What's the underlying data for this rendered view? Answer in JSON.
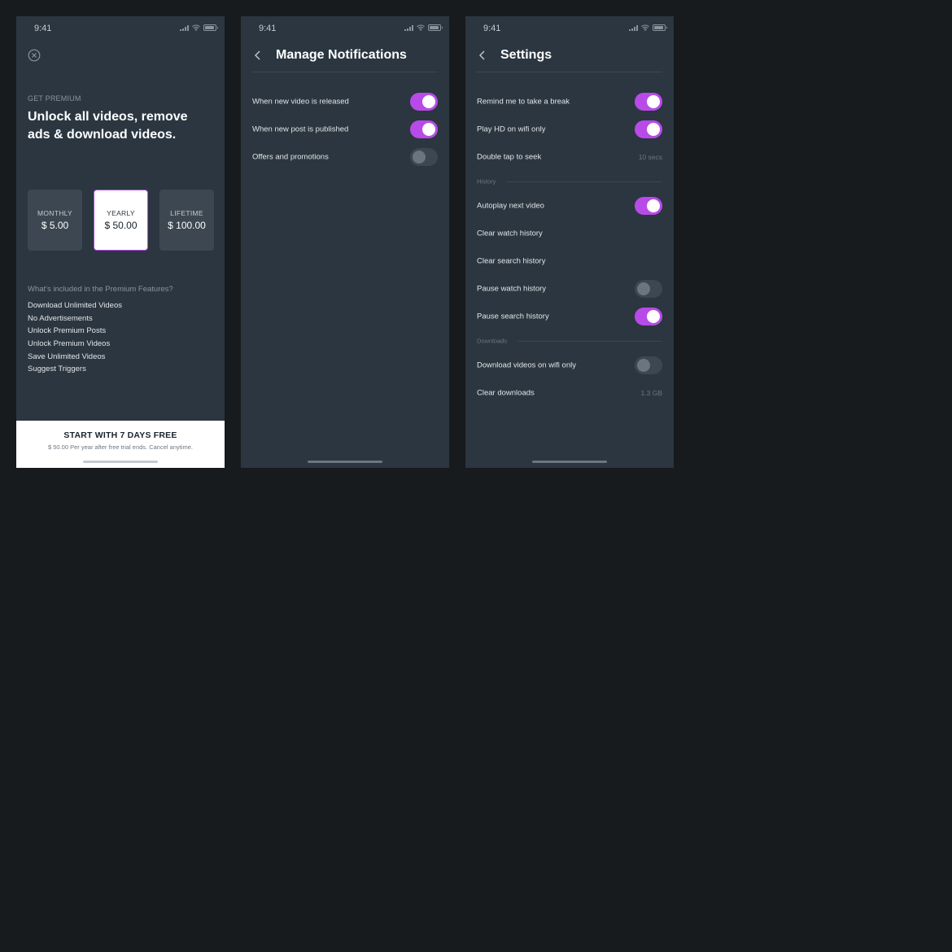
{
  "status_time": "9:41",
  "colors": {
    "accent": "#b84be8",
    "screen_bg": "#2b3640",
    "page_bg": "#171b1e"
  },
  "premium": {
    "kicker": "GET PREMIUM",
    "headline": "Unlock all videos, remove ads & download videos.",
    "plans": [
      {
        "label": "MONTHLY",
        "price": "$ 5.00",
        "selected": false
      },
      {
        "label": "YEARLY",
        "price": "$ 50.00",
        "selected": true
      },
      {
        "label": "LIFETIME",
        "price": "$ 100.00",
        "selected": false
      }
    ],
    "features_title": "What's included in the Premium Features?",
    "features": [
      "Download Unlimited Videos",
      "No Advertisements",
      "Unlock Premium Posts",
      "Unlock Premium Videos",
      "Save Unlimited Videos",
      "Suggest Triggers"
    ],
    "cta_title": "START WITH 7 DAYS FREE",
    "cta_subtitle": "$ 50.00 Per year after free trial ends. Cancel anytime."
  },
  "notifications": {
    "title": "Manage Notifications",
    "items": [
      {
        "label": "When new video is released",
        "on": true
      },
      {
        "label": "When new post is published",
        "on": true
      },
      {
        "label": "Offers and promotions",
        "on": false
      }
    ]
  },
  "settings": {
    "title": "Settings",
    "rows": [
      {
        "label": "Remind me to take a break",
        "toggle": true
      },
      {
        "label": "Play HD on wifi only",
        "toggle": true
      },
      {
        "label": "Double tap to seek",
        "value": "10 secs"
      },
      {
        "section": "History"
      },
      {
        "label": "Autoplay next video",
        "toggle": true
      },
      {
        "label": "Clear watch history"
      },
      {
        "label": "Clear search history"
      },
      {
        "label": "Pause watch history",
        "toggle": false
      },
      {
        "label": "Pause search history",
        "toggle": true
      },
      {
        "section": "Downloads"
      },
      {
        "label": "Download videos on wifi only",
        "toggle": false
      },
      {
        "label": "Clear downloads",
        "value": "1.3 GB"
      }
    ]
  }
}
